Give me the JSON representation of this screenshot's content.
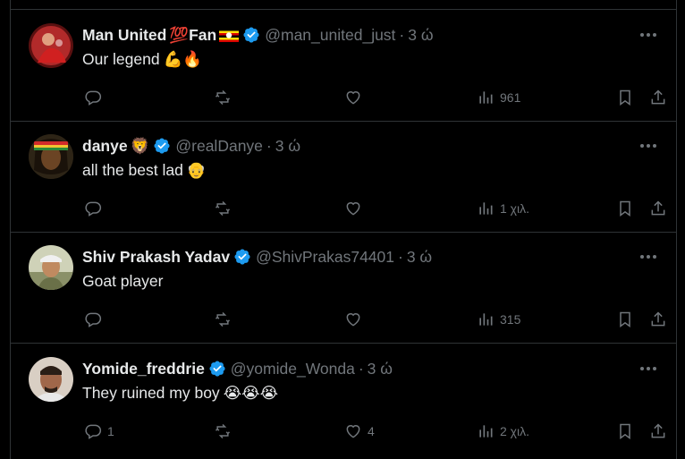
{
  "tweets": [
    {
      "name": "Man United",
      "name_emoji": "💯",
      "name_suffix": "Fan",
      "handle": "@man_united_just",
      "time": "3 ώ",
      "text": "Our legend",
      "text_emoji": "💪🔥",
      "reply_count": "",
      "retweet_count": "",
      "like_count": "",
      "views": "961",
      "avatar_color": "#b12a2a"
    },
    {
      "name": "danye",
      "name_emoji": "🦁",
      "name_suffix": "",
      "handle": "@realDanye",
      "time": "3 ώ",
      "text": "all the best lad",
      "text_emoji": "👴",
      "reply_count": "",
      "retweet_count": "",
      "like_count": "",
      "views": "1 χιλ.",
      "avatar_color": "#3a2a1a"
    },
    {
      "name": "Shiv Prakash Yadav",
      "name_emoji": "",
      "name_suffix": "",
      "handle": "@ShivPrakas74401",
      "time": "3 ώ",
      "text": "Goat player",
      "text_emoji": "",
      "reply_count": "",
      "retweet_count": "",
      "like_count": "",
      "views": "315",
      "avatar_color": "#9aa07a"
    },
    {
      "name": "Yomide_freddrie",
      "name_emoji": "",
      "name_suffix": "",
      "handle": "@yomide_Wonda",
      "time": "3 ώ",
      "text": "They ruined my boy",
      "text_emoji": "😭😭😭",
      "reply_count": "1",
      "retweet_count": "",
      "like_count": "4",
      "views": "2 χιλ.",
      "avatar_color": "#c9b8a8"
    }
  ],
  "colors": {
    "background": "#000000",
    "divider": "#2f3336",
    "text": "#e7e9ea",
    "muted": "#71767b",
    "verified": "#1d9bf0"
  }
}
